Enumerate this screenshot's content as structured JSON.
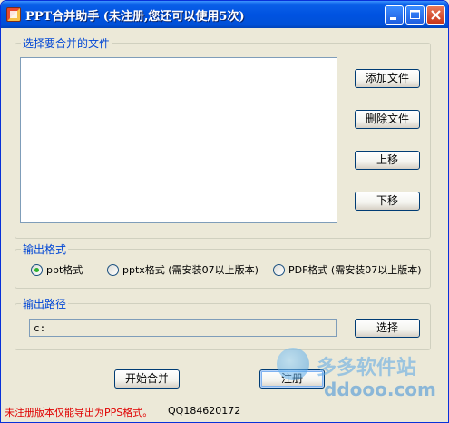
{
  "window": {
    "title": "PPT合并助手 (未注册,您还可以使用5次)"
  },
  "files_group": {
    "label": "选择要合并的文件",
    "add_button": "添加文件",
    "delete_button": "删除文件",
    "up_button": "上移",
    "down_button": "下移"
  },
  "format_group": {
    "label": "输出格式",
    "options": [
      {
        "label": "ppt格式",
        "checked": true
      },
      {
        "label": "pptx格式 (需安装07以上版本)",
        "checked": false
      },
      {
        "label": "PDF格式 (需安装07以上版本)",
        "checked": false
      }
    ]
  },
  "path_group": {
    "label": "输出路径",
    "value": "c:",
    "choose_button": "选择"
  },
  "actions": {
    "start_button": "开始合并",
    "register_button": "注册"
  },
  "footer": {
    "warning": "未注册版本仅能导出为PPS格式。",
    "qq": "QQ184620172"
  },
  "watermark": {
    "cn": "多多软件站",
    "en": "ddooo.com"
  },
  "colors": {
    "titlebar": "#0053e1",
    "group_label": "#0046d5",
    "warning": "#e00000",
    "background": "#ece9d8"
  }
}
